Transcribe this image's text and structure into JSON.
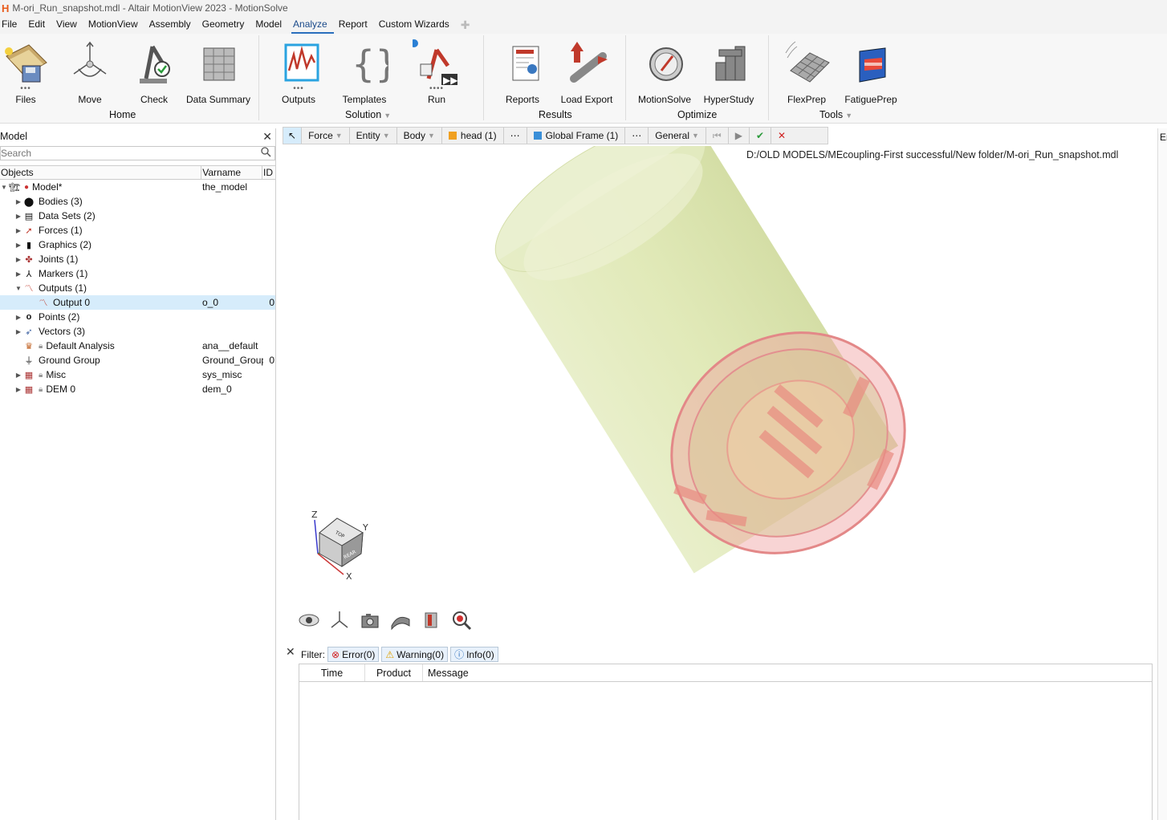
{
  "window": {
    "title": "M-ori_Run_snapshot.mdl - Altair MotionView 2023 - MotionSolve",
    "logo": "H"
  },
  "menu": [
    "File",
    "Edit",
    "View",
    "MotionView",
    "Assembly",
    "Geometry",
    "Model",
    "Analyze",
    "Report",
    "Custom Wizards"
  ],
  "menu_active": "Analyze",
  "ribbon": {
    "tools": {
      "files": "Files",
      "move": "Move",
      "check": "Check",
      "data_summary": "Data Summary",
      "outputs": "Outputs",
      "templates": "Templates",
      "run": "Run",
      "reports": "Reports",
      "load_export": "Load Export",
      "motionsolve": "MotionSolve",
      "hyperstudy": "HyperStudy",
      "flexprep": "FlexPrep",
      "fatigueprep": "FatiguePrep"
    },
    "groups": {
      "home": "Home",
      "solution": "Solution",
      "results": "Results",
      "optimize": "Optimize",
      "tools": "Tools"
    }
  },
  "left_panel": {
    "title": "Model",
    "search_placeholder": "Search",
    "columns": {
      "objects": "Objects",
      "varname": "Varname",
      "id": "ID"
    },
    "tree": [
      {
        "label": "Model*",
        "varname": "the_model",
        "id": "",
        "icon": "model-icon"
      },
      {
        "label": "Bodies  (3)",
        "varname": "",
        "id": "",
        "icon": "bodies-icon"
      },
      {
        "label": "Data Sets  (2)",
        "varname": "",
        "id": "",
        "icon": "datasets-icon"
      },
      {
        "label": "Forces  (1)",
        "varname": "",
        "id": "",
        "icon": "forces-icon"
      },
      {
        "label": "Graphics  (2)",
        "varname": "",
        "id": "",
        "icon": "graphics-icon"
      },
      {
        "label": "Joints  (1)",
        "varname": "",
        "id": "",
        "icon": "joints-icon"
      },
      {
        "label": "Markers  (1)",
        "varname": "",
        "id": "",
        "icon": "markers-icon"
      },
      {
        "label": "Outputs  (1)",
        "varname": "",
        "id": "",
        "icon": "outputs-icon"
      },
      {
        "label": "Output 0",
        "varname": "o_0",
        "id": "0",
        "icon": "output-icon"
      },
      {
        "label": "Points  (2)",
        "varname": "",
        "id": "",
        "icon": "points-icon"
      },
      {
        "label": "Vectors  (3)",
        "varname": "",
        "id": "",
        "icon": "vectors-icon"
      },
      {
        "label": "Default Analysis",
        "varname": "ana__default",
        "id": "",
        "icon": "analysis-icon"
      },
      {
        "label": "Ground Group",
        "varname": "Ground_Group",
        "id": "0",
        "icon": "ground-icon"
      },
      {
        "label": "Misc",
        "varname": "sys_misc",
        "id": "",
        "icon": "misc-icon"
      },
      {
        "label": "DEM 0",
        "varname": "dem_0",
        "id": "",
        "icon": "dem-icon"
      }
    ]
  },
  "view_toolbar": {
    "force": "Force",
    "entity": "Entity",
    "body": "Body",
    "head": "head (1)",
    "more": "⋯",
    "frame": "Global Frame (1)",
    "general": "General"
  },
  "viewport": {
    "file_path": "D:/OLD MODELS/MEcoupling-First successful/New folder/M-ori_Run_snapshot.mdl",
    "axes": {
      "z": "Z",
      "y": "Y",
      "x": "X"
    },
    "cube": {
      "top": "TOP",
      "rear": "REAR"
    }
  },
  "message_panel": {
    "filter_label": "Filter:",
    "error": "Error(0)",
    "warning": "Warning(0)",
    "info": "Info(0)",
    "columns": {
      "time": "Time",
      "product": "Product",
      "message": "Message"
    }
  },
  "right_panel": {
    "label": "Er"
  }
}
